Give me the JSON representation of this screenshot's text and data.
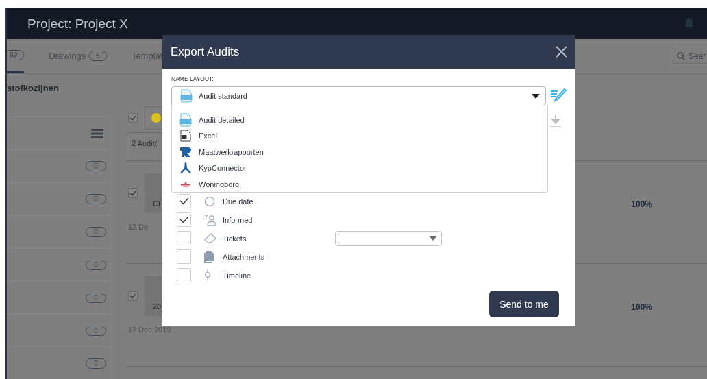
{
  "header": {
    "title": "Project: Project X"
  },
  "tabs": [
    {
      "count": "99",
      "selected": true
    },
    {
      "label": "Drawings",
      "count": "5",
      "selected": false
    },
    {
      "label": "Templat",
      "selected": false
    }
  ],
  "search": {
    "placeholder": "Sear"
  },
  "section_title": "stofkozijnen",
  "left_rows": [
    "0",
    "0",
    "0",
    "0",
    "0",
    "0",
    "0"
  ],
  "toolbar": {
    "checked": true,
    "audit_count": "2 Audit("
  },
  "cards": [
    {
      "checked": true,
      "code": "CF",
      "date": "12 De",
      "progress": "100%"
    },
    {
      "checked": true,
      "code": "20(",
      "date": "12 Dec 2019",
      "progress": "100%"
    }
  ],
  "modal": {
    "title": "Export Audits",
    "field_label": "NAME LAYOUT:",
    "selected_layout": "Audit standard",
    "options": [
      "Audit detailed",
      "Excel",
      "Maatwerkrapporten",
      "KypConnector",
      "Woningborg"
    ],
    "items": [
      {
        "kind": "check",
        "label": "Due date",
        "checked": true
      },
      {
        "kind": "check",
        "label": "Informed",
        "checked": true
      },
      {
        "kind": "check-select",
        "label": "Tickets",
        "checked": false
      },
      {
        "kind": "check",
        "label": "Attachments",
        "checked": false
      },
      {
        "kind": "check",
        "label": "Timeline",
        "checked": false
      }
    ],
    "button": "Send to me"
  }
}
